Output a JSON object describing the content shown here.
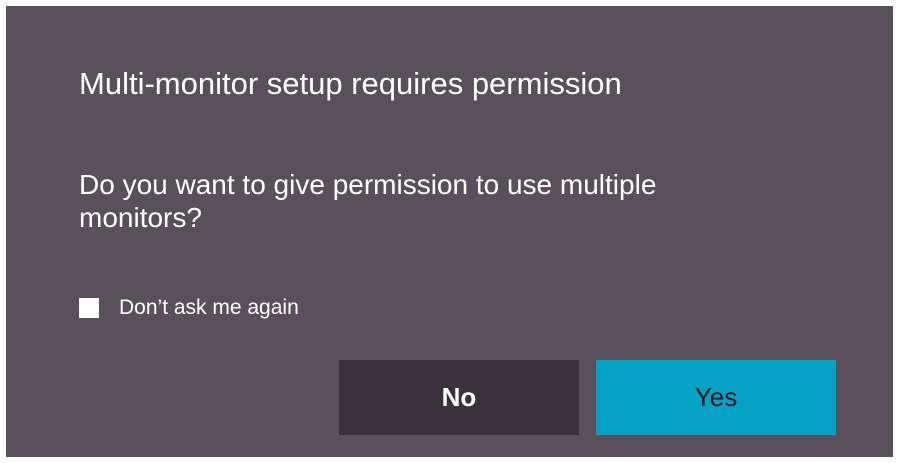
{
  "dialog": {
    "title": "Multi-monitor setup requires permission",
    "message": "Do you want to give permission to use multiple monitors?",
    "checkbox": {
      "label": "Don’t ask me again",
      "checked": false
    },
    "buttons": {
      "no_label": "No",
      "yes_label": "Yes"
    },
    "colors": {
      "background": "#5a505c",
      "no_button": "#3b313d",
      "yes_button": "#05a2c6"
    }
  }
}
